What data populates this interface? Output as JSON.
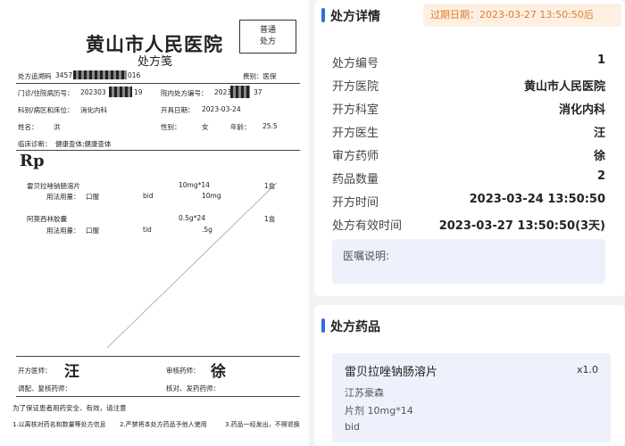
{
  "prescription": {
    "hospital": "黄山市人民医院",
    "subtitle": "处方笺",
    "stamp": [
      "普通",
      "处方"
    ],
    "trace_label": "处方追溯码",
    "trace_value": "3457",
    "trace_value_end": "016",
    "fee_label": "费别：医保",
    "outpatient_label": "门诊/住院病历号：",
    "outpatient_value": "202303",
    "outpatient_value_end": "19",
    "hosp_no_label": "院内处方编号：",
    "hosp_no_value": "2023",
    "hosp_no_value_end": "37",
    "dept_label": "科别/病区和床位：",
    "dept_value": "消化内科",
    "issue_label": "开具日期：",
    "issue_value": "2023-03-24",
    "name_label": "姓名：",
    "name_value": "洪",
    "sex_label": "性别：",
    "sex_value": "女",
    "age_label": "年龄：",
    "age_value": "25.5",
    "diag_label": "临床诊断：",
    "diag_value": "健康查体;健康查体",
    "rp": "Rp",
    "meds": [
      {
        "name": "雷贝拉唑钠肠溶片",
        "spec": "10mg*14",
        "qty": "1盒",
        "usage_label": "用法用量：",
        "route": "口服",
        "freq": "bid",
        "dose": "10mg"
      },
      {
        "name": "阿莫西林胶囊",
        "spec": "0.5g*24",
        "qty": "1盒",
        "usage_label": "用法用量：",
        "route": "口服",
        "freq": "tid",
        "dose": ".5g"
      }
    ],
    "doctor_label": "开方医师：",
    "doctor_sig": "汪",
    "pharm_label": "审核药师：",
    "pharm_sig": "徐",
    "adjust_label": "调配、复核药师：",
    "dispense_label": "核对、发药药师：",
    "footer1": "为了保证患者用药安全、有效，请注意",
    "footer2": "1.以离核对药名和数量等处方信息",
    "footer3": "2.严禁将本处方药品予他人使用",
    "footer4": "3.药品一经发出，不得退换"
  },
  "details": {
    "title": "处方详情",
    "expiry": "过期日期：2023-03-27 13:50:50后",
    "rows": [
      {
        "k": "处方编号",
        "v": "1"
      },
      {
        "k": "开方医院",
        "v": "黄山市人民医院"
      },
      {
        "k": "开方科室",
        "v": "消化内科"
      },
      {
        "k": "开方医生",
        "v": "汪"
      },
      {
        "k": "审方药师",
        "v": "徐"
      },
      {
        "k": "药品数量",
        "v": "2"
      },
      {
        "k": "开方时间",
        "v": "2023-03-24 13:50:50"
      },
      {
        "k": "处方有效时间",
        "v": "2023-03-27 13:50:50(3天)"
      }
    ],
    "note_label": "医嘱说明:"
  },
  "drugs_card": {
    "title": "处方药品",
    "drug_name": "雷贝拉唑钠肠溶片",
    "drug_qty": "x1.0",
    "maker": "江苏豪森",
    "spec": "片剂 10mg*14",
    "freq": "bid"
  },
  "colors": {
    "accent": "#2f6fde",
    "expiry_text": "#e07b2a",
    "expiry_bg": "#fdf0e2",
    "note_bg": "#eef0fb"
  }
}
